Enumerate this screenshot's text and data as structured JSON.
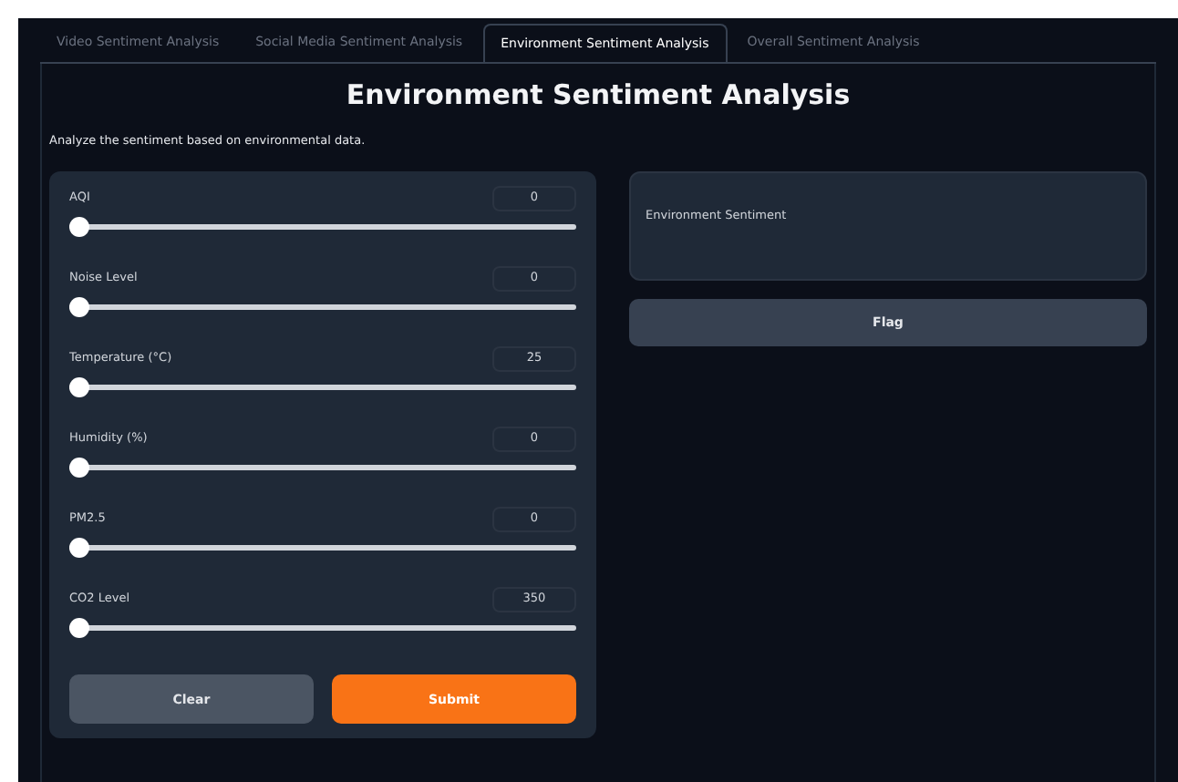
{
  "tabs": [
    {
      "label": "Video Sentiment Analysis",
      "selected": false
    },
    {
      "label": "Social Media Sentiment Analysis",
      "selected": false
    },
    {
      "label": "Environment Sentiment Analysis",
      "selected": true
    },
    {
      "label": "Overall Sentiment Analysis",
      "selected": false
    }
  ],
  "title": "Environment Sentiment Analysis",
  "description": "Analyze the sentiment based on environmental data.",
  "sliders": [
    {
      "label": "AQI",
      "value": "0",
      "level": 0
    },
    {
      "label": "Noise Level",
      "value": "0",
      "level": 0
    },
    {
      "label": "Temperature (°C)",
      "value": "25",
      "level": 0
    },
    {
      "label": "Humidity (%)",
      "value": "0",
      "level": 0
    },
    {
      "label": "PM2.5",
      "value": "0",
      "level": 0
    },
    {
      "label": "CO2 Level",
      "value": "350",
      "level": 0
    }
  ],
  "buttons": {
    "clear": "Clear",
    "submit": "Submit"
  },
  "output": {
    "label": "Environment Sentiment"
  },
  "flag": "Flag"
}
